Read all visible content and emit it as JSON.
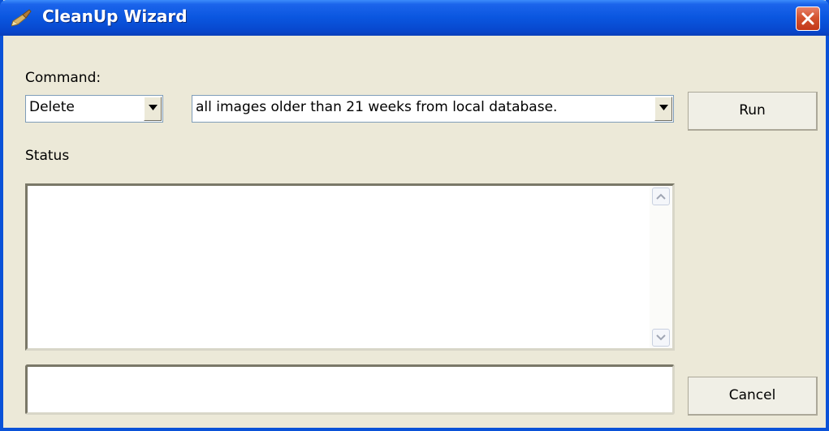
{
  "window": {
    "title": "CleanUp Wizard",
    "app_icon": "broom-icon",
    "close_icon": "close-icon"
  },
  "command": {
    "label": "Command:",
    "action_value": "Delete",
    "target_value": "all images older than 21 weeks from local database."
  },
  "buttons": {
    "run_label": "Run",
    "cancel_label": "Cancel"
  },
  "status": {
    "label": "Status",
    "log_text": "",
    "input_value": ""
  },
  "colors": {
    "titlebar": "#0a56df",
    "background": "#ece9d8",
    "close_button": "#d4532f"
  }
}
